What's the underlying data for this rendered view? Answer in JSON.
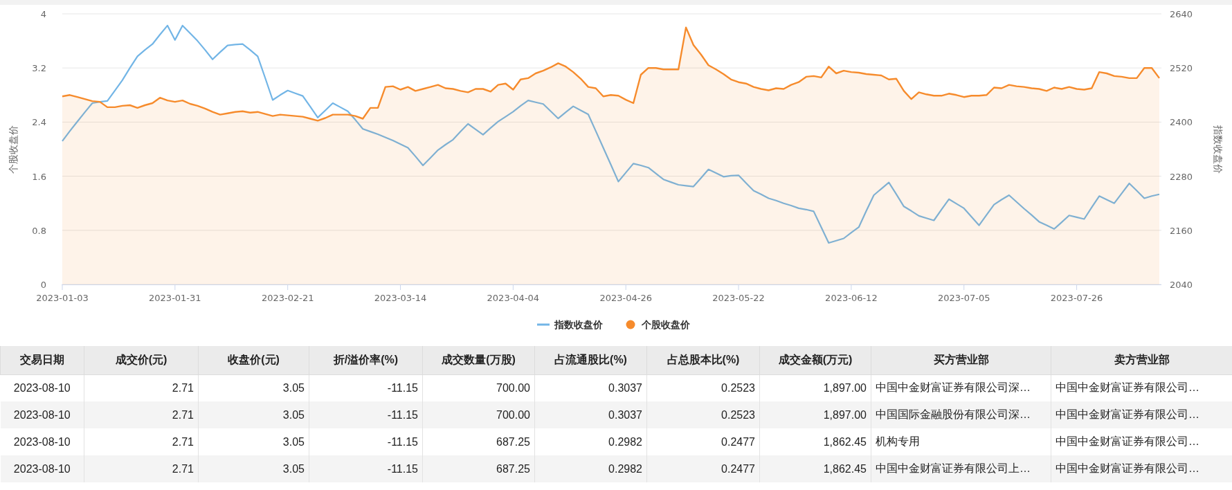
{
  "chart": {
    "chart_data": {
      "type": "line",
      "categories": [
        "2023-01-03",
        null,
        null,
        null,
        null,
        null,
        null,
        null,
        null,
        null,
        null,
        null,
        null,
        null,
        null,
        "2023-01-31",
        null,
        null,
        null,
        null,
        null,
        null,
        null,
        null,
        null,
        null,
        null,
        null,
        null,
        null,
        "2023-02-21",
        null,
        null,
        null,
        null,
        null,
        null,
        null,
        null,
        null,
        null,
        null,
        null,
        null,
        null,
        "2023-03-14",
        null,
        null,
        null,
        null,
        null,
        null,
        null,
        null,
        null,
        null,
        null,
        null,
        null,
        null,
        "2023-04-04",
        null,
        null,
        null,
        null,
        null,
        null,
        null,
        null,
        null,
        null,
        null,
        null,
        null,
        null,
        "2023-04-26",
        null,
        null,
        null,
        null,
        null,
        null,
        null,
        null,
        null,
        null,
        null,
        null,
        null,
        null,
        "2023-05-22",
        null,
        null,
        null,
        null,
        null,
        null,
        null,
        null,
        null,
        null,
        null,
        null,
        null,
        null,
        "2023-06-12",
        null,
        null,
        null,
        null,
        null,
        null,
        null,
        null,
        null,
        null,
        null,
        null,
        null,
        null,
        "2023-07-05",
        null,
        null,
        null,
        null,
        null,
        null,
        null,
        null,
        null,
        null,
        null,
        null,
        null,
        null,
        "2023-07-26",
        null,
        null,
        null,
        null,
        null,
        null,
        null,
        null,
        null,
        null,
        null
      ],
      "series": [
        {
          "name": "指数收盘价",
          "color": "#72b5e6",
          "axis": "y2",
          "type": "line",
          "values": [
            2358,
            2380,
            2401,
            2422,
            2442,
            2445,
            2447,
            2470,
            2493,
            2520,
            2546,
            2560,
            2573,
            2594,
            2614,
            2582,
            2614,
            2597,
            2580,
            2560,
            2539,
            2555,
            2570,
            2572,
            2573,
            2560,
            2546,
            2498,
            2449,
            2460,
            2470,
            2464,
            2458,
            2434,
            2410,
            2426,
            2442,
            2433,
            2424,
            2405,
            2385,
            2379,
            2373,
            2366,
            2359,
            2351,
            2343,
            2324,
            2304,
            2321,
            2338,
            2350,
            2361,
            2379,
            2396,
            2384,
            2372,
            2387,
            2401,
            2412,
            2423,
            2436,
            2448,
            2444,
            2440,
            2424,
            2408,
            2422,
            2435,
            2426,
            2417,
            2380,
            2343,
            2306,
            2268,
            2288,
            2308,
            2304,
            2299,
            2286,
            2273,
            2267,
            2261,
            2259,
            2257,
            2276,
            2295,
            2287,
            2279,
            2281,
            2282,
            2265,
            2248,
            2240,
            2231,
            2226,
            2220,
            2215,
            2209,
            2206,
            2202,
            2167,
            2132,
            2137,
            2142,
            2155,
            2167,
            2203,
            2238,
            2252,
            2266,
            2240,
            2213,
            2203,
            2192,
            2187,
            2182,
            2206,
            2229,
            2219,
            2209,
            2190,
            2171,
            2194,
            2217,
            2228,
            2238,
            2223,
            2208,
            2194,
            2179,
            2171,
            2163,
            2178,
            2193,
            2189,
            2185,
            2211,
            2236,
            2228,
            2220,
            2242,
            2264,
            2248,
            2231,
            2236,
            2240
          ]
        },
        {
          "name": "个股收盘价",
          "color": "#f68b2c",
          "type": "area",
          "values": [
            2.78,
            2.8,
            2.77,
            2.74,
            2.71,
            2.7,
            2.62,
            2.62,
            2.64,
            2.65,
            2.61,
            2.65,
            2.68,
            2.76,
            2.72,
            2.7,
            2.72,
            2.67,
            2.64,
            2.6,
            2.55,
            2.51,
            2.53,
            2.55,
            2.56,
            2.54,
            2.55,
            2.52,
            2.49,
            2.51,
            2.5,
            2.49,
            2.48,
            2.45,
            2.42,
            2.46,
            2.51,
            2.51,
            2.51,
            2.49,
            2.45,
            2.61,
            2.61,
            2.92,
            2.93,
            2.88,
            2.92,
            2.86,
            2.89,
            2.92,
            2.95,
            2.9,
            2.89,
            2.86,
            2.84,
            2.89,
            2.89,
            2.85,
            2.95,
            2.97,
            2.88,
            3.03,
            3.05,
            3.12,
            3.16,
            3.21,
            3.27,
            3.22,
            3.14,
            3.04,
            2.92,
            2.9,
            2.78,
            2.8,
            2.79,
            2.73,
            2.68,
            3.1,
            3.2,
            3.2,
            3.18,
            3.18,
            3.18,
            3.8,
            3.54,
            3.4,
            3.24,
            3.18,
            3.11,
            3.03,
            2.99,
            2.97,
            2.92,
            2.89,
            2.87,
            2.9,
            2.89,
            2.95,
            2.99,
            3.07,
            3.08,
            3.06,
            3.22,
            3.12,
            3.16,
            3.14,
            3.13,
            3.11,
            3.1,
            3.09,
            3.03,
            3.04,
            2.86,
            2.74,
            2.84,
            2.81,
            2.79,
            2.79,
            2.82,
            2.8,
            2.77,
            2.79,
            2.79,
            2.8,
            2.91,
            2.9,
            2.95,
            2.93,
            2.92,
            2.9,
            2.89,
            2.86,
            2.91,
            2.89,
            2.92,
            2.89,
            2.88,
            2.9,
            3.14,
            3.12,
            3.08,
            3.07,
            3.05,
            3.05,
            3.2,
            3.2,
            3.05
          ]
        }
      ],
      "ylabel": "个股收盘价",
      "ylim": [
        0,
        4
      ],
      "yticks": [
        0,
        0.8,
        1.6,
        2.4,
        3.2,
        4
      ],
      "grid": true,
      "legend": "bottom",
      "y2label": "指数收盘价",
      "y2lim": [
        2040,
        2640
      ],
      "y2ticks": [
        2040,
        2160,
        2280,
        2400,
        2520,
        2640
      ]
    }
  },
  "table": {
    "columns": [
      "交易日期",
      "成交价(元)",
      "收盘价(元)",
      "折/溢价率(%)",
      "成交数量(万股)",
      "占流通股比(%)",
      "占总股本比(%)",
      "成交金额(万元)",
      "买方营业部",
      "卖方营业部"
    ],
    "rows": [
      [
        "2023-08-10",
        "2.71",
        "3.05",
        "-11.15",
        "700.00",
        "0.3037",
        "0.2523",
        "1,897.00",
        "中国中金财富证券有限公司深…",
        "中国中金财富证券有限公司…"
      ],
      [
        "2023-08-10",
        "2.71",
        "3.05",
        "-11.15",
        "700.00",
        "0.3037",
        "0.2523",
        "1,897.00",
        "中国国际金融股份有限公司深…",
        "中国中金财富证券有限公司…"
      ],
      [
        "2023-08-10",
        "2.71",
        "3.05",
        "-11.15",
        "687.25",
        "0.2982",
        "0.2477",
        "1,862.45",
        "机构专用",
        "中国中金财富证券有限公司…"
      ],
      [
        "2023-08-10",
        "2.71",
        "3.05",
        "-11.15",
        "687.25",
        "0.2982",
        "0.2477",
        "1,862.45",
        "中国中金财富证券有限公司上…",
        "中国中金财富证券有限公司…"
      ]
    ]
  }
}
